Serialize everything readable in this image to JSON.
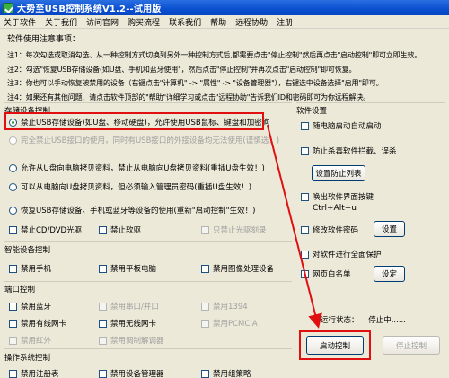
{
  "window": {
    "title": "大势至USB控制系统V1.2--试用版"
  },
  "menu": [
    "关于软件",
    "关于我们",
    "访问官网",
    "购买流程",
    "联系我们",
    "帮助",
    "远程协助",
    "注册"
  ],
  "notes": {
    "heading": "软件使用注意事项：",
    "lines": [
      "注1：每次勾选或取消勾选、从一种控制方式切换到另外一种控制方式后,都需要点击\"停止控制\"然后再点击\"启动控制\"即可立即生效。",
      "注2：勾选\"恢复USB存储设备(如U盘、手机和蓝牙使用\"，然后点击\"停止控制\"并再次点击\"启动控制\"即可恢复。",
      "注3：你也可以手动恢复被禁用的设备（右键点击\"计算机\" -> \"属性\" -> \"设备管理器\"），右键选中设备选择\"启用\"即可。",
      "注4：如果还有其他问题，请点击软件顶部的\"帮助\"详细学习或点击\"远程协助\"告诉我们ID和密码即可为你远程解决。"
    ]
  },
  "storage": {
    "title": "存储设备控制",
    "options": [
      "禁止USB存储设备(如U盘、移动硬盘)，允许使用USB鼠标、键盘和加密狗",
      "完全禁止USB接口的使用，同时有USB接口的外接设备均无法使用(谨慎选！)",
      "允许从U盘向电脑拷贝资料，禁止从电脑向U盘拷贝资料(重插U盘生效！)",
      "可以从电脑向U盘拷贝资料，但必须输入管理员密码(重插U盘生效！)",
      "恢复USB存储设备、手机或蓝牙等设备的使用(重新\"启动控制\"生效！)"
    ],
    "checks": [
      "禁止CD/DVD光驱",
      "禁止软驱",
      "只禁止光驱刻录"
    ]
  },
  "smart": {
    "title": "智能设备控制",
    "checks": [
      "禁用手机",
      "禁用平板电脑",
      "禁用图像处理设备"
    ]
  },
  "port": {
    "title": "端口控制",
    "checks": [
      "禁用蓝牙",
      "禁用串口/并口",
      "禁用1394",
      "禁用有线网卡",
      "禁用无线网卡",
      "禁用PCMCIA",
      "禁用红外",
      "禁用调制解调器"
    ]
  },
  "os": {
    "title": "操作系统控制",
    "checks": [
      "禁用注册表",
      "禁用设备管理器",
      "禁用组策略"
    ]
  },
  "settings": {
    "title": "软件设置",
    "autostart": "随电脑启动自动启动",
    "antikill": "防止杀毒软件拦截、误杀",
    "antikill_btn": "设置防止列表",
    "hotkey_label": "唤出软件界面按键",
    "hotkey_value": "Ctrl+Alt+u",
    "password": "修改软件密码",
    "password_btn": "设置",
    "protect": "对软件进行全面保护",
    "whitelist": "网页白名单",
    "whitelist_btn": "设定"
  },
  "status": {
    "label": "运行状态：",
    "value": "停止中......"
  },
  "actions": {
    "start": "启动控制",
    "stop": "停止控制"
  },
  "colors": {
    "title_bar": "#0a4fd1",
    "annotation_red": "#e01010",
    "panel_bg": "#ece9d8"
  }
}
